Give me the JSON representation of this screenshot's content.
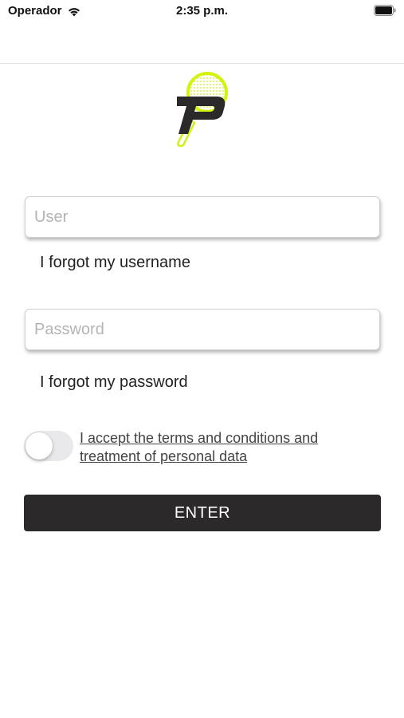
{
  "status_bar": {
    "carrier": "Operador",
    "time": "2:35 p.m."
  },
  "logo": {
    "icon": "padel-racket-p-logo",
    "accent_color": "#d4f20c",
    "dark_color": "#2b292a"
  },
  "form": {
    "user_placeholder": "User",
    "user_value": "",
    "forgot_username": "I forgot my username",
    "password_placeholder": "Password",
    "password_value": "",
    "forgot_password": "I forgot my password",
    "terms_toggle_on": false,
    "terms_text": "I accept the terms and conditions and treatment of personal data",
    "enter_label": "ENTER"
  },
  "colors": {
    "button_bg": "#2b292a",
    "button_text": "#ffffff",
    "toggle_off": "#e9e9eb"
  }
}
